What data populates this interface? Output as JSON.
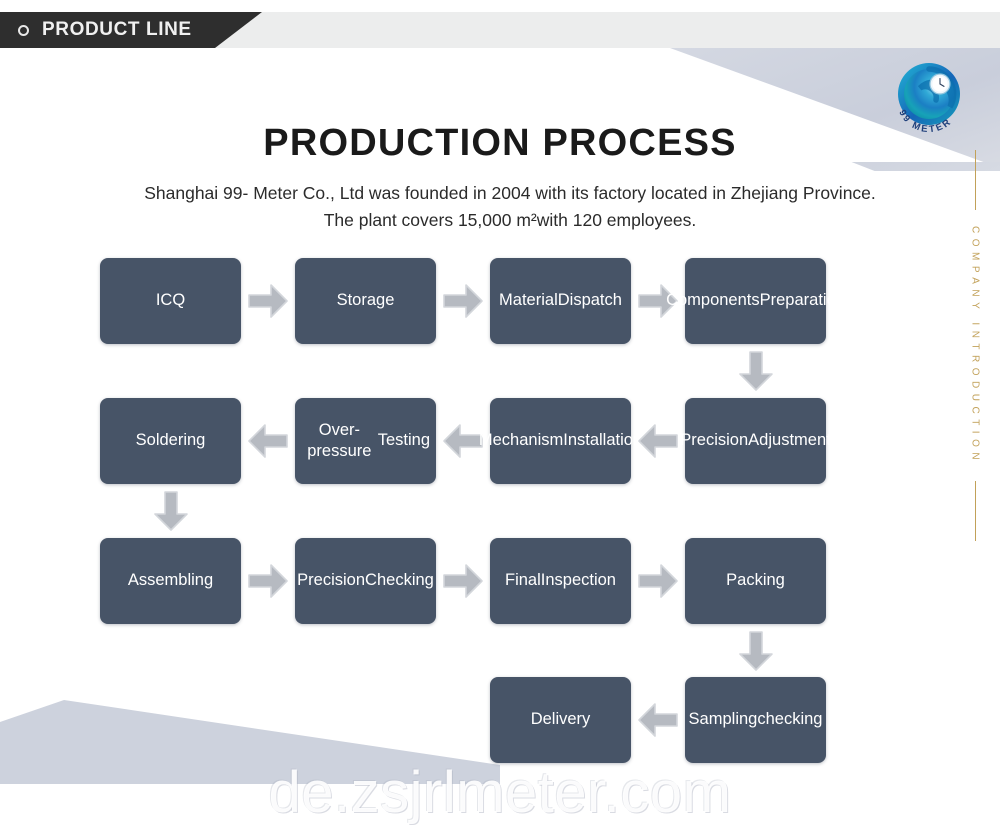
{
  "header": {
    "tab_label": "PRODUCT LINE",
    "dot_icon": "circle-outline-icon",
    "tab_bg": "#2e2e2e",
    "bar_bg": "#eceded"
  },
  "brand": {
    "logo_icon": "99-meter-swirl-logo",
    "logo_text": "99 METER",
    "side_label": "COMPANY INTRODUCTION",
    "side_label_color": "#c2a159"
  },
  "page": {
    "title": "PRODUCTION PROCESS",
    "intro_line1": "Shanghai 99- Meter Co., Ltd was founded in 2004 with its factory located in Zhejiang",
    "intro_line2": "Province. The plant covers 15,000 m²with 120 employees."
  },
  "theme": {
    "node_bg": "#475467",
    "node_text": "#ffffff",
    "arrow_fill": "#b6bac1",
    "arrow_stroke": "#d3d6db",
    "deco_fill": "#cdd2dd"
  },
  "flow": {
    "rows": [
      {
        "direction": "ltr",
        "nodes": [
          {
            "id": "icq",
            "label": "ICQ"
          },
          {
            "id": "storage",
            "label": "Storage"
          },
          {
            "id": "material-dispatch",
            "line1": "Material",
            "line2": "Dispatch"
          },
          {
            "id": "components-preparation",
            "line1": "Components",
            "line2": "Preparation"
          }
        ]
      },
      {
        "direction": "rtl",
        "nodes": [
          {
            "id": "soldering",
            "label": "Soldering"
          },
          {
            "id": "over-pressure-testing",
            "line1": "Over-pressure",
            "line2": "Testing"
          },
          {
            "id": "mechanism-installation",
            "line1": "Mechanism",
            "line2": "Installation"
          },
          {
            "id": "precision-adjustment",
            "line1": "Precision",
            "line2": "Adjustment"
          }
        ]
      },
      {
        "direction": "ltr",
        "nodes": [
          {
            "id": "assembling",
            "label": "Assembling"
          },
          {
            "id": "precision-checking",
            "line1": "Precision",
            "line2": "Checking"
          },
          {
            "id": "final-inspection",
            "line1": "Final",
            "line2": "Inspection"
          },
          {
            "id": "packing",
            "label": "Packing"
          }
        ]
      },
      {
        "direction": "rtl",
        "nodes": [
          {
            "id": "delivery",
            "label": "Delivery"
          },
          {
            "id": "sampling-checking",
            "line1": "Sampling",
            "line2": "checking"
          }
        ]
      }
    ]
  },
  "watermark": {
    "text": "de.zsjrlmeter.com"
  }
}
